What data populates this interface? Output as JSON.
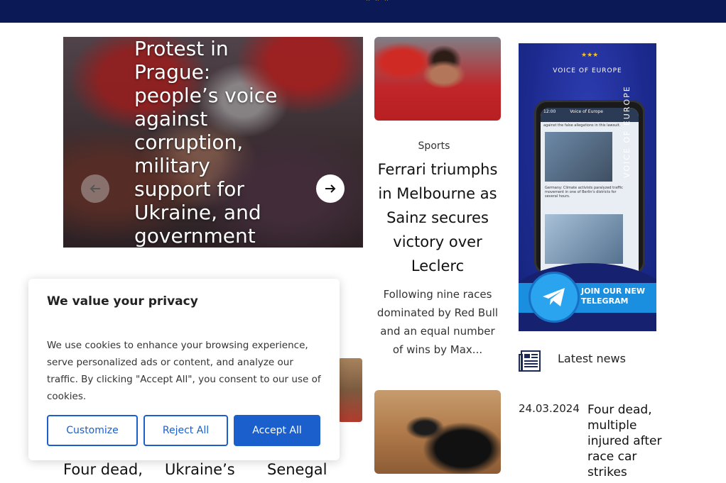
{
  "colors": {
    "topbar": "#0b1a57",
    "accent": "#1a5fcc",
    "ad_bg": "#1c2a8f",
    "telegram": "#2aa4ef"
  },
  "header": {
    "stars": "★ ★ ★"
  },
  "hero": {
    "title": "Protest in Prague: people’s voice against corruption, military support for Ukraine, and government",
    "prev_icon": "arrow-left-icon",
    "next_icon": "arrow-right-icon"
  },
  "featured": {
    "category": "Sports",
    "title": "Ferrari triumphs in Melbourne as Sainz secures victory over Leclerc",
    "excerpt": "Following nine races dominated by Red Bull and an equal number of wins by Max..."
  },
  "ad": {
    "brand": "VOICE OF EUROPE",
    "vertical_brand": "VOICE OF EUROPE",
    "phone_time": "12:00",
    "phone_app": "Voice of Europe",
    "phone_post_1": "against the false allegations in this lawsuit.",
    "phone_post_2": "Germany: Climate activists paralyzed traffic movement in one of Berlin's districts for several hours.",
    "cta": "JOIN OUR NEW TELEGRAM"
  },
  "latest": {
    "label": "Latest news",
    "items": [
      {
        "date": "24.03.2024",
        "title": "Four dead, multiple injured after race car strikes"
      }
    ]
  },
  "bottom_titles": [
    "Four dead,",
    "Ukraine’s",
    "Senegal"
  ],
  "cookie": {
    "title": "We value your privacy",
    "body": "We use cookies to enhance your browsing experience, serve personalized ads or content, and analyze our traffic. By clicking \"Accept All\", you consent to our use of cookies.",
    "customize": "Customize",
    "reject": "Reject All",
    "accept": "Accept All"
  }
}
